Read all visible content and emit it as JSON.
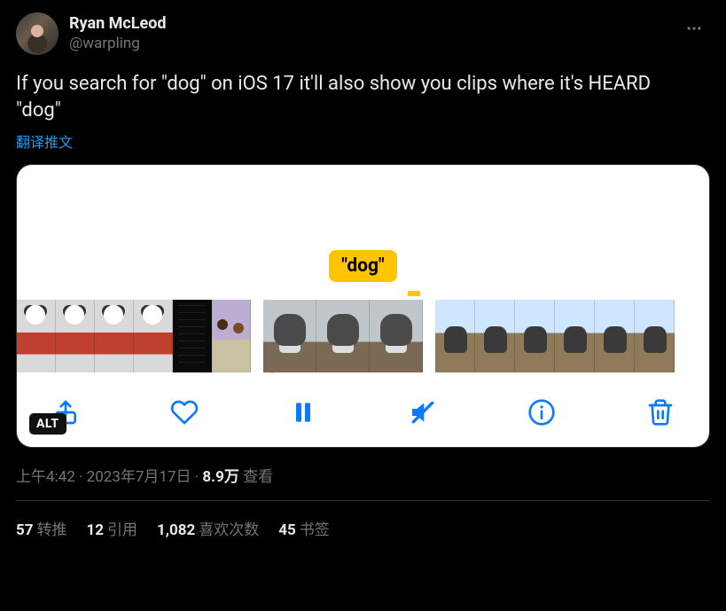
{
  "author": {
    "display_name": "Ryan McLeod",
    "handle": "@warpling"
  },
  "tweet_text": "If you search for \"dog\" on iOS 17 it'll also show you clips where it's HEARD \"dog\"",
  "translate_label": "翻译推文",
  "media": {
    "badge_text": "\"dog\"",
    "alt_badge": "ALT"
  },
  "meta": {
    "time": "上午4:42",
    "separator": " · ",
    "date": "2023年7月17日",
    "views_count": "8.9万",
    "views_label": "查看"
  },
  "stats": {
    "retweets_count": "57",
    "retweets_label": "转推",
    "quotes_count": "12",
    "quotes_label": "引用",
    "likes_count": "1,082",
    "likes_label": "喜欢次数",
    "bookmarks_count": "45",
    "bookmarks_label": "书签"
  }
}
